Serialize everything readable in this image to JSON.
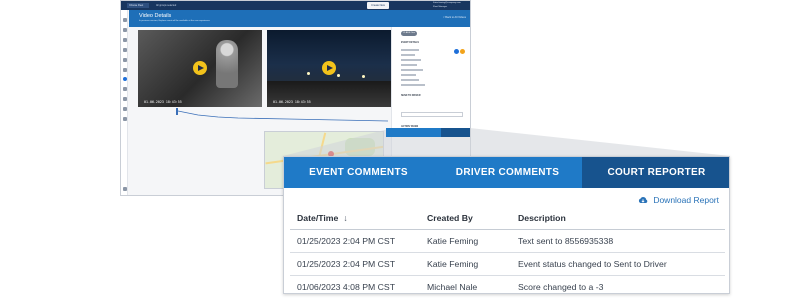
{
  "background_app": {
    "topbar": {
      "selector_label": "Choose Fleet",
      "vehicle_label": "All groups selected",
      "new_button": "Create New",
      "account_line1": "Katie.feming@company.com",
      "account_line2": "Fleet Manager"
    },
    "title": "Video Details",
    "subtitle": "In previous version, Explore event will be available at the new experience",
    "back_link": "< Back to All Videos",
    "video_timestamps": [
      "01.06.2023 18:43:55",
      "01.06.2023 18:43:55"
    ],
    "right_panel": {
      "pill": "CLASS One",
      "event_details_heading": "EVENT DETAILS",
      "send_to_driver_heading": "SEND TO DRIVER",
      "action_taken_heading": "ACTION TAKEN",
      "action_value": "Reviewed with Driver"
    },
    "mini_tabs": [
      "EVENT COMMENTS",
      "DRIVER COMMENTS",
      "COURT REPORTER"
    ]
  },
  "court_reporter": {
    "tabs": [
      {
        "label": "EVENT COMMENTS",
        "active": false
      },
      {
        "label": "DRIVER COMMENTS",
        "active": false
      },
      {
        "label": "COURT REPORTER",
        "active": true
      }
    ],
    "download_label": "Download Report",
    "columns": {
      "datetime": "Date/Time",
      "created_by": "Created By",
      "description": "Description"
    },
    "sort_icon": "arrow-down-icon",
    "rows": [
      {
        "datetime": "01/25/2023 2:04 PM CST",
        "created_by": "Katie Feming",
        "description": "Text sent to 8556935338"
      },
      {
        "datetime": "01/25/2023 2:04 PM CST",
        "created_by": "Katie Feming",
        "description": "Event status changed to Sent to Driver"
      },
      {
        "datetime": "01/06/2023 4:08 PM CST",
        "created_by": "Michael Nale",
        "description": "Score changed to a -3"
      }
    ]
  },
  "colors": {
    "header_navy": "#18365f",
    "tab_blue": "#1f7ac7",
    "tab_active": "#17538e",
    "link_blue": "#2a73b8",
    "map_pin": "#e53935",
    "play_button": "#f2c21b"
  }
}
